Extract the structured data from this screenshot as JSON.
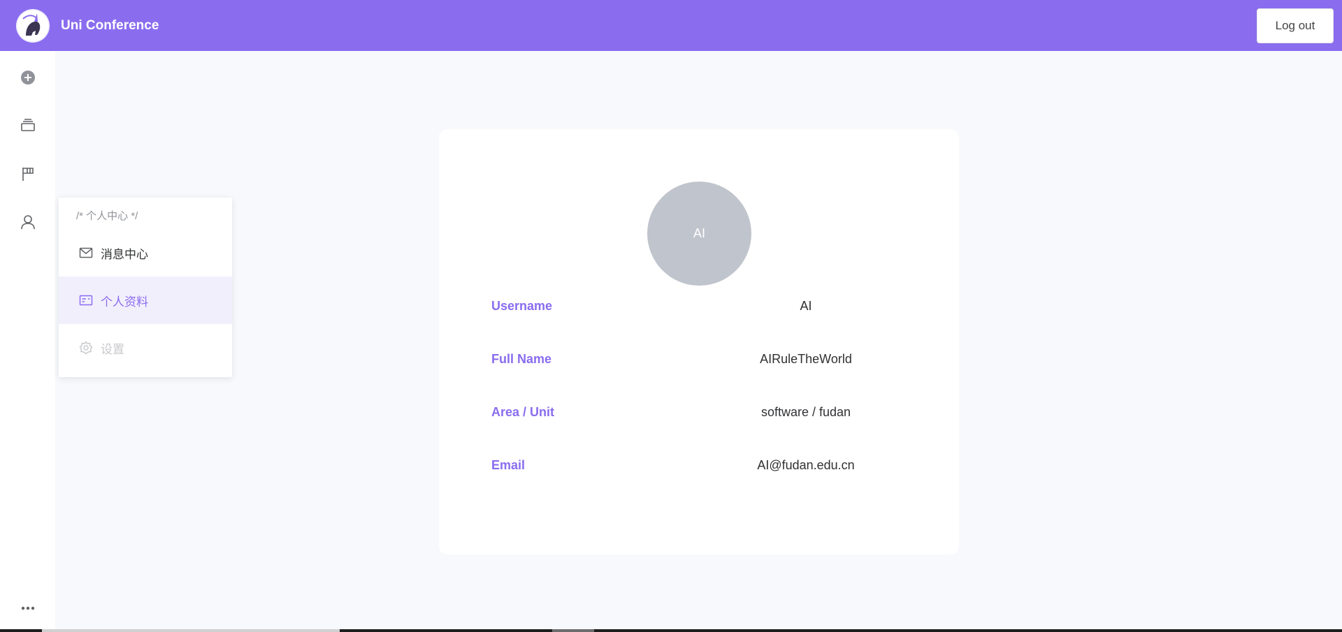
{
  "header": {
    "title": "Uni Conference",
    "logout_label": "Log out"
  },
  "rail": {
    "icons": [
      "add-circle-icon",
      "stack-icon",
      "flag-icon",
      "user-icon",
      "more-icon"
    ]
  },
  "submenu": {
    "group_title": "/* 个人中心 */",
    "items": [
      {
        "label": "消息中心",
        "icon": "mail-icon",
        "state": "normal"
      },
      {
        "label": "个人资料",
        "icon": "id-card-icon",
        "state": "active"
      },
      {
        "label": "设置",
        "icon": "gear-icon",
        "state": "disabled"
      }
    ]
  },
  "profile": {
    "avatar_text": "AI",
    "rows": [
      {
        "label": "Username",
        "value": "AI"
      },
      {
        "label": "Full Name",
        "value": "AIRuleTheWorld"
      },
      {
        "label": "Area / Unit",
        "value": "software / fudan"
      },
      {
        "label": "Email",
        "value": "AI@fudan.edu.cn"
      }
    ]
  },
  "colors": {
    "accent": "#8a6cef",
    "background": "#f8f9fd",
    "avatar": "#c0c4cc"
  }
}
